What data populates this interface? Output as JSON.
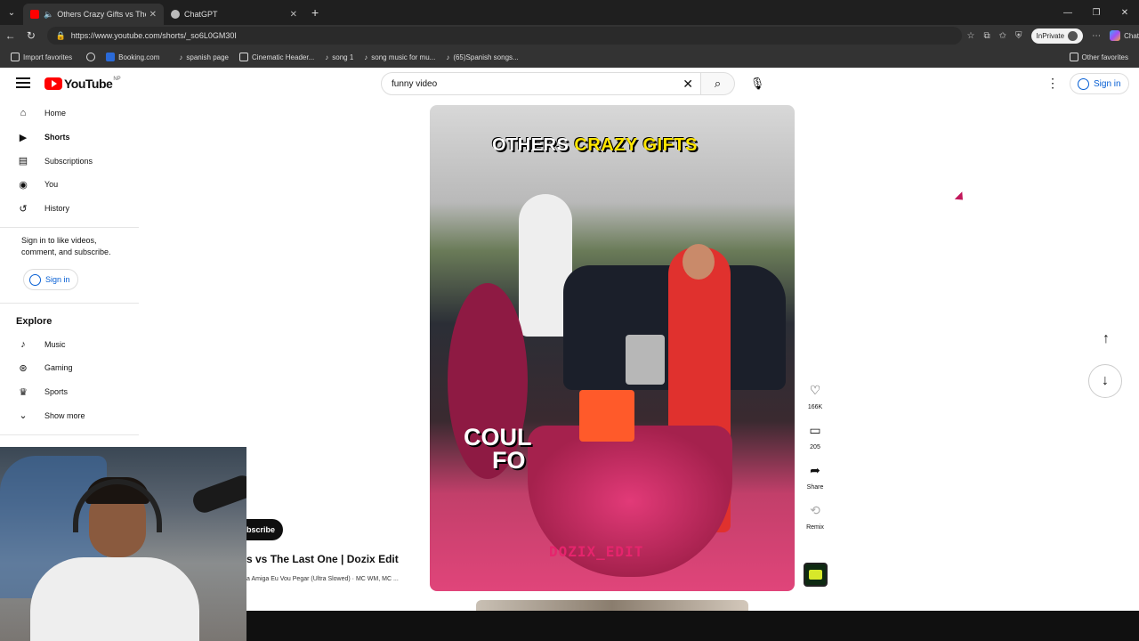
{
  "browser": {
    "tabs": [
      {
        "label": "Others Crazy Gifts vs The Last",
        "active": true
      },
      {
        "label": "ChatGPT",
        "active": false
      }
    ],
    "url": "https://www.youtube.com/shorts/_so6L0GM30I",
    "inprivate_label": "InPrivate",
    "chat_label": "Chat",
    "favorites": [
      "Import favorites",
      "Booking.com",
      "spanish page",
      "Cinematic Header...",
      "song 1",
      "song music for mu...",
      "(65)Spanish songs..."
    ],
    "other_favorites": "Other favorites"
  },
  "header": {
    "logo_word": "YouTube",
    "region": "NP",
    "search_value": "funny video",
    "signin": "Sign in"
  },
  "sidebar": {
    "items": [
      {
        "label": "Home",
        "icon": "home-icon"
      },
      {
        "label": "Shorts",
        "icon": "shorts-icon",
        "active": true
      },
      {
        "label": "Subscriptions",
        "icon": "subscriptions-icon"
      },
      {
        "label": "You",
        "icon": "you-icon"
      },
      {
        "label": "History",
        "icon": "history-icon"
      }
    ],
    "signin_note": "Sign in to like videos, comment, and subscribe.",
    "signin_button": "Sign in",
    "explore_title": "Explore",
    "explore_items": [
      {
        "label": "Music",
        "icon": "music-icon"
      },
      {
        "label": "Gaming",
        "icon": "gaming-icon"
      },
      {
        "label": "Sports",
        "icon": "trophy-icon"
      },
      {
        "label": "Show more",
        "icon": "chevron-down-icon"
      }
    ]
  },
  "short": {
    "overlay_title_white": "OTHERS",
    "overlay_title_yellow": "CRAZY GIFTS",
    "caption_line1": "COUL",
    "caption_line2": "FO",
    "watermark": "DOZIX_EDIT",
    "title_partial": "s vs The Last One | Dozix Edit",
    "music_partial": "a Amiga Eu Vou Pegar (Ultra Slowed) · MC WM, MC ...",
    "subscribe_partial": "bscribe"
  },
  "actions": {
    "likes": "166K",
    "comments": "205",
    "share": "Share",
    "remix": "Remix"
  }
}
